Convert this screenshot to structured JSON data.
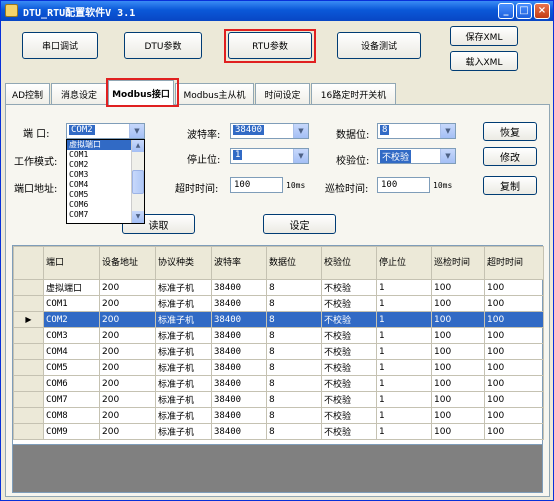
{
  "window": {
    "title": "DTU_RTU配置软件V 3.1",
    "minimize": "_",
    "maximize": "□",
    "close": "×"
  },
  "top_buttons": {
    "serial_debug": "串口调试",
    "dtu_params": "DTU参数",
    "rtu_params": "RTU参数",
    "device_test": "设备测试",
    "save_xml": "保存XML",
    "load_xml": "载入XML"
  },
  "tabs": [
    "AD控制",
    "消息设定",
    "Modbus接口",
    "Modbus主从机",
    "时间设定",
    "16路定时开关机"
  ],
  "form": {
    "port_label": "端  口:",
    "port_value": "COM2",
    "baud_label": "波特率:",
    "baud_value": "38400",
    "databits_label": "数据位:",
    "databits_value": "8",
    "workmode_label": "工作模式:",
    "stopbits_label": "停止位:",
    "stopbits_value": "1",
    "parity_label": "校验位:",
    "parity_value": "不校验",
    "addr_label": "端口地址:",
    "timeout_label": "超时时间:",
    "timeout_value": "100",
    "timeout_unit": "10ms",
    "poll_label": "巡检时间:",
    "poll_value": "100",
    "poll_unit": "10ms",
    "restore_btn": "恢复",
    "modify_btn": "修改",
    "copy_btn": "复制",
    "read_btn": "读取",
    "set_btn": "设定"
  },
  "port_dropdown": [
    "虚拟端口",
    "COM1",
    "COM2",
    "COM3",
    "COM4",
    "COM5",
    "COM6",
    "COM7"
  ],
  "icons": {
    "dropdown_arrow": "▼",
    "scroll_up": "▲",
    "scroll_down": "▼",
    "row_pointer": "▶"
  },
  "table": {
    "headers": [
      "端口",
      "设备地址",
      "协议种类",
      "波特率",
      "数据位",
      "校验位",
      "停止位",
      "巡检时间",
      "超时时间"
    ],
    "rows": [
      [
        "虚拟端口",
        "200",
        "标准子机",
        "38400",
        "8",
        "不校验",
        "1",
        "100",
        "100"
      ],
      [
        "COM1",
        "200",
        "标准子机",
        "38400",
        "8",
        "不校验",
        "1",
        "100",
        "100"
      ],
      [
        "COM2",
        "200",
        "标准子机",
        "38400",
        "8",
        "不校验",
        "1",
        "100",
        "100"
      ],
      [
        "COM3",
        "200",
        "标准子机",
        "38400",
        "8",
        "不校验",
        "1",
        "100",
        "100"
      ],
      [
        "COM4",
        "200",
        "标准子机",
        "38400",
        "8",
        "不校验",
        "1",
        "100",
        "100"
      ],
      [
        "COM5",
        "200",
        "标准子机",
        "38400",
        "8",
        "不校验",
        "1",
        "100",
        "100"
      ],
      [
        "COM6",
        "200",
        "标准子机",
        "38400",
        "8",
        "不校验",
        "1",
        "100",
        "100"
      ],
      [
        "COM7",
        "200",
        "标准子机",
        "38400",
        "8",
        "不校验",
        "1",
        "100",
        "100"
      ],
      [
        "COM8",
        "200",
        "标准子机",
        "38400",
        "8",
        "不校验",
        "1",
        "100",
        "100"
      ],
      [
        "COM9",
        "200",
        "标准子机",
        "38400",
        "8",
        "不校验",
        "1",
        "100",
        "100"
      ]
    ],
    "selected_row": 2
  },
  "colors": {
    "selection": "#316ac5",
    "highlight_box": "#e02020",
    "titlebar": "#0a58d8"
  }
}
